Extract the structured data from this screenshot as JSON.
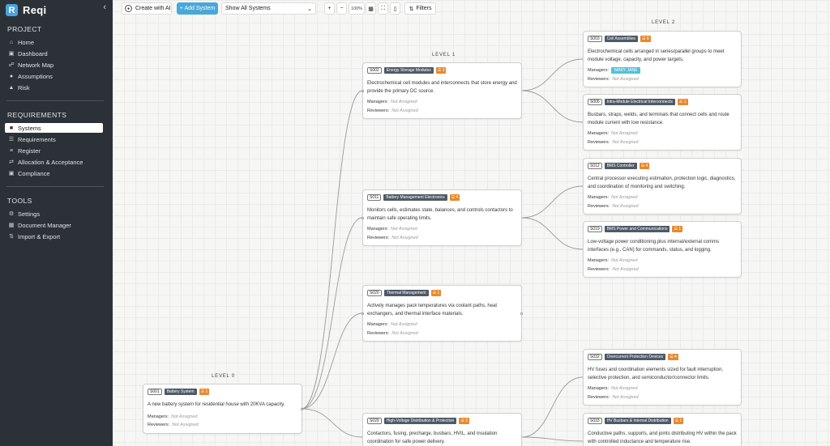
{
  "app": {
    "name": "Reqi",
    "logo_letter": "R"
  },
  "sidebar": {
    "sections": [
      {
        "title": "PROJECT",
        "items": [
          {
            "label": "Home",
            "icon": "home-icon"
          },
          {
            "label": "Dashboard",
            "icon": "dashboard-icon"
          },
          {
            "label": "Network Map",
            "icon": "network-map-icon"
          },
          {
            "label": "Assumptions",
            "icon": "lightbulb-icon"
          },
          {
            "label": "Risk",
            "icon": "warning-icon"
          }
        ]
      },
      {
        "title": "REQUIREMENTS",
        "items": [
          {
            "label": "Systems",
            "icon": "systems-icon",
            "active": true
          },
          {
            "label": "Requirements",
            "icon": "requirements-icon"
          },
          {
            "label": "Register",
            "icon": "register-icon"
          },
          {
            "label": "Allocation & Acceptance",
            "icon": "allocation-icon"
          },
          {
            "label": "Compliance",
            "icon": "compliance-icon"
          }
        ]
      },
      {
        "title": "TOOLS",
        "items": [
          {
            "label": "Settings",
            "icon": "settings-icon"
          },
          {
            "label": "Document Manager",
            "icon": "document-icon"
          },
          {
            "label": "Import & Export",
            "icon": "import-export-icon"
          }
        ]
      }
    ]
  },
  "toolbar": {
    "create_ai": "Create with AI",
    "add_system": "+ Add System",
    "system_select": "Show All Systems",
    "zoom": "100%",
    "filters": "Filters"
  },
  "levels": [
    "LEVEL 0",
    "LEVEL 1",
    "LEVEL 2"
  ],
  "labels": {
    "managers": "Managers:",
    "reviewers": "Reviewers:",
    "not_assigned": "Not Assigned"
  },
  "cards": [
    {
      "id": "S001",
      "name": "Battery System",
      "count": "1",
      "desc": "A new battery system for residential house with 20KVA capacity.",
      "manager": "Not Assigned",
      "reviewer": "Not Assigned"
    },
    {
      "id": "S002",
      "name": "Energy Storage Modules",
      "count": "3",
      "desc": "Electrochemical cell modules and interconnects that store energy and provide the primary DC source.",
      "manager": "Not Assigned",
      "reviewer": "Not Assigned"
    },
    {
      "id": "S011",
      "name": "Battery Management Electronics",
      "count": "4",
      "desc": "Monitors cells, estimates state, balances, and controls contactors to maintain safe operating limits.",
      "manager": "Not Assigned",
      "reviewer": "Not Assigned"
    },
    {
      "id": "S020",
      "name": "Thermal Management",
      "count": "1",
      "desc": "Actively manages pack temperatures via coolant paths, heat exchangers, and thermal interface materials.",
      "manager": "Not Assigned",
      "reviewer": "Not Assigned"
    },
    {
      "id": "S029",
      "name": "High-Voltage Distribution & Protection",
      "count": "3",
      "desc": "Contactors, fusing, precharge, busbars, HVIL, and insulation coordination for safe power delivery.",
      "manager": "",
      "reviewer": ""
    },
    {
      "id": "S003",
      "name": "Cell Assemblies",
      "count": "8",
      "desc": "Electrochemical cells arranged in series/parallel groups to meet module voltage, capacity, and power targets.",
      "manager": "MARY JANE",
      "reviewer": "Not Assigned"
    },
    {
      "id": "S006",
      "name": "Intra-Module Electrical Interconnects",
      "count": "1",
      "desc": "Busbars, straps, welds, and terminals that connect cells and route module current with low resistance.",
      "manager": "Not Assigned",
      "reviewer": "Not Assigned"
    },
    {
      "id": "S012",
      "name": "BMS Controller",
      "count": "4",
      "desc": "Central processor executing estimation, protection logic, diagnostics, and coordination of monitoring and switching.",
      "manager": "Not Assigned",
      "reviewer": "Not Assigned"
    },
    {
      "id": "S019",
      "name": "BMS Power and Communications",
      "count": "1",
      "desc": "Low-voltage power conditioning plus internal/external comms interfaces (e.g., CAN) for commands, status, and logging.",
      "manager": "Not Assigned",
      "reviewer": "Not Assigned"
    },
    {
      "id": "S032",
      "name": "Overcurrent Protection Devices",
      "count": "4",
      "desc": "HV fuses and coordination elements sized for fault interruption, selective protection, and semiconductor/connector limits.",
      "manager": "Not Assigned",
      "reviewer": "Not Assigned"
    },
    {
      "id": "S033",
      "name": "HV Busbars & Internal Distribution",
      "count": "1",
      "desc": "Conductive paths, supports, and joints distributing HV within the pack with controlled inductance and temperature rise.",
      "manager": "",
      "reviewer": ""
    }
  ],
  "colors": {
    "sidebar_bg": "#2c3138",
    "accent": "#4aa8d8",
    "count_badge": "#e8892e",
    "name_badge": "#4e5a66",
    "manager_tag": "#56c0d8"
  }
}
